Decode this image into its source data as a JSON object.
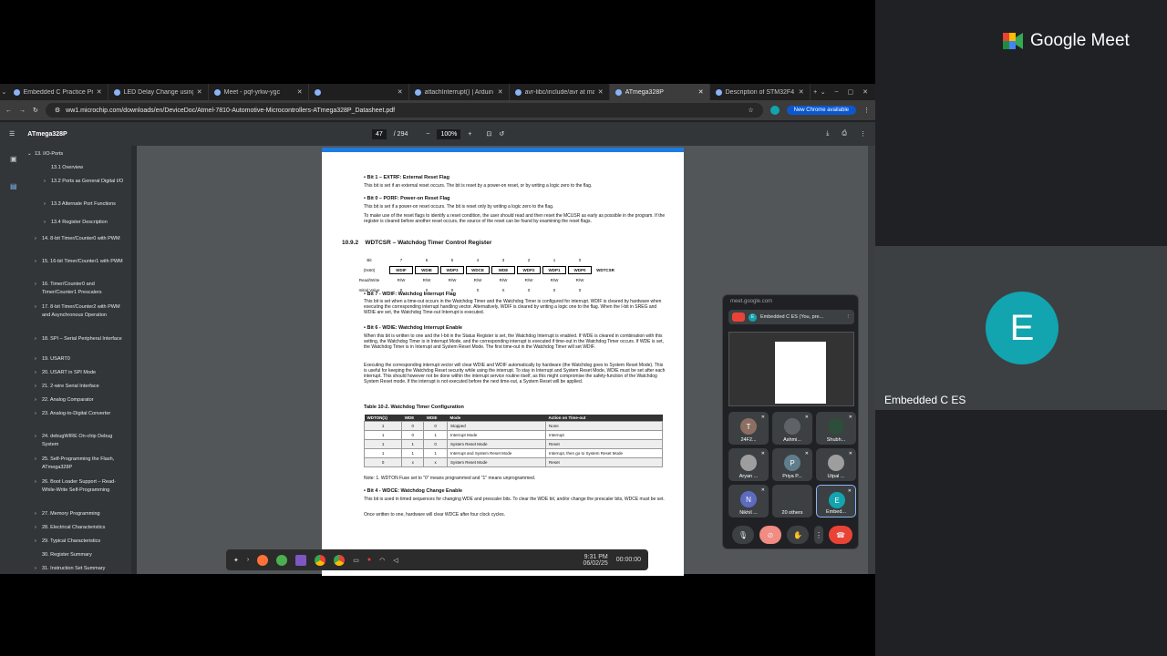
{
  "meet": {
    "logo_text": "Google Meet",
    "right_name": "Embedded C ES",
    "right_initial": "E",
    "popup_url": "meet.google.com",
    "presenting_label": "Embedded C ES (You, pre...",
    "popup_initial": "E"
  },
  "tiles": [
    {
      "name": "24F2...",
      "initial": "T",
      "bg": "#8d6e63"
    },
    {
      "name": "Ashmi...",
      "initial": "",
      "bg": "#5f6368"
    },
    {
      "name": "Shubh...",
      "initial": "",
      "bg": "#2e4d3a"
    },
    {
      "name": "Aryan ...",
      "initial": "",
      "bg": "#9e9e9e"
    },
    {
      "name": "Priya P...",
      "initial": "P",
      "bg": "#607d8b"
    },
    {
      "name": "Utpal ...",
      "initial": "",
      "bg": "#9e9e9e"
    },
    {
      "name": "Nikhil ...",
      "initial": "N",
      "bg": "#5c6bc0"
    },
    {
      "name": "20 others",
      "initial": "",
      "bg": "#3c4043"
    },
    {
      "name": "Embed...",
      "initial": "E",
      "bg": "#12a4af"
    }
  ],
  "browser": {
    "tabs": [
      "Embedded C Practice Prog",
      "LED Delay Change using",
      "Meet - pqf-yrkw-ygc",
      "",
      "attachInterrupt() | Arduin",
      "avr-libc/include/avr at ma",
      "ATmega328P",
      "Description of STM32F4 H"
    ],
    "active_tab": 6,
    "url": "ww1.microchip.com/downloads/en/DeviceDoc/Atmel-7810-Automotive-Microcontrollers-ATmega328P_Datasheet.pdf",
    "new_chrome": "New Chrome available"
  },
  "pdf": {
    "title": "ATmega328P",
    "page": "47",
    "total": "/ 294",
    "zoom": "100%"
  },
  "sidebar": [
    "13. I/O-Ports",
    "13.1 Overview",
    "13.2 Ports as General Digital I/O",
    "13.3 Alternate Port Functions",
    "13.4 Register Description",
    "14. 8-bit Timer/Counter0 with PWM",
    "15. 16-bit Timer/Counter1 with PWM",
    "16. Timer/Counter0 and Timer/Counter1 Prescalers",
    "17. 8-bit Timer/Counter2 with PWM and Asynchronous Operation",
    "18. SPI – Serial Peripheral Interface",
    "19. USART0",
    "20. USART in SPI Mode",
    "21. 2-wire Serial Interface",
    "22. Analog Comparator",
    "23. Analog-to-Digital Converter",
    "24. debugWIRE On-chip Debug System",
    "25. Self-Programming the Flash, ATmega328P",
    "26. Boot Loader Support – Read-While-Write Self-Programming",
    "27. Memory Programming",
    "28. Electrical Characteristics",
    "29. Typical Characteristics",
    "30. Register Summary",
    "31. Instruction Set Summary"
  ],
  "doc": {
    "b1_head": "Bit 1 – EXTRF: External Reset Flag",
    "b1_text": "This bit is set if an external reset occurs. The bit is reset by a power-on reset, or by writing a logic zero to the flag.",
    "b0_head": "Bit 0 – PORF: Power-on Reset Flag",
    "b0_text": "This bit is set if a power-on reset occurs. The bit is reset only by writing a logic zero to the flag.",
    "reset_text": "To make use of the reset flags to identify a reset condition, the user should read and then reset the MCUSR as early as possible in the program. If the register is cleared before another reset occurs, the source of the reset can be found by examining the reset flags.",
    "sec_num": "10.9.2",
    "sec_title": "WDTCSR – Watchdog Timer Control Register",
    "reg_bits": [
      "7",
      "6",
      "5",
      "4",
      "3",
      "2",
      "1",
      "0"
    ],
    "reg_names": [
      "WDIF",
      "WDIE",
      "WDP3",
      "WDCE",
      "WDE",
      "WDP2",
      "WDP1",
      "WDP0"
    ],
    "reg_rw": [
      "R/W",
      "R/W",
      "R/W",
      "R/W",
      "R/W",
      "R/W",
      "R/W",
      "R/W"
    ],
    "reg_init": [
      "0",
      "0",
      "0",
      "0",
      "X",
      "0",
      "0",
      "0"
    ],
    "reg_label": "WDTCSR",
    "reg_addr": "(0x60)",
    "row_bit": "Bit",
    "row_rw": "Read/Write",
    "row_init": "Initial Value",
    "b7_head": "Bit 7 - WDIF: Watchdog Interrupt Flag",
    "b7_text": "This bit is set when a time-out occurs in the Watchdog Timer and the Watchdog Timer is configured for interrupt. WDIF is cleared by hardware when executing the corresponding interrupt handling vector. Alternatively, WDIF is cleared by writing a logic one to the flag. When the I-bit in SREG and WDIE are set, the Watchdog Time-out Interrupt is executed.",
    "b6_head": "Bit 6 - WDIE: Watchdog Interrupt Enable",
    "b6_text": "When this bit is written to one and the I-bit in the Status Register is set, the Watchdog Interrupt is enabled. If WDE is cleared in combination with this setting, the Watchdog Timer is in Interrupt Mode, and the corresponding interrupt is executed if time-out in the Watchdog Timer occurs. If WDE is set, the Watchdog Timer is in Interrupt and System Reset Mode. The first time-out in the Watchdog Timer will set WDIF.",
    "b6_text2": "Executing the corresponding interrupt vector will clear WDIE and WDIF automatically by hardware (the Watchdog goes to System Reset Mode). This is useful for keeping the Watchdog Reset security while using the interrupt. To stay in Interrupt and System Reset Mode, WDIE must be set after each interrupt. This should however not be done within the interrupt service routine itself, as this might compromise the safety-function of the Watchdog System Reset mode. If the interrupt is not executed before the next time-out, a System Reset will be applied.",
    "table_title": "Table 10-2.   Watchdog Timer Configuration",
    "table_headers": [
      "WDTON(1)",
      "WDE",
      "WDIE",
      "Mode",
      "Action on Time-out"
    ],
    "table_rows": [
      [
        "1",
        "0",
        "0",
        "Stopped",
        "None"
      ],
      [
        "1",
        "0",
        "1",
        "Interrupt Mode",
        "Interrupt"
      ],
      [
        "1",
        "1",
        "0",
        "System Reset Mode",
        "Reset"
      ],
      [
        "1",
        "1",
        "1",
        "Interrupt and System Reset Mode",
        "Interrupt, then go to System Reset Mode"
      ],
      [
        "0",
        "x",
        "x",
        "System Reset Mode",
        "Reset"
      ]
    ],
    "note": "Note:    1.    WDTON Fuse set to \"0\" means programmed and \"1\" means unprogrammed.",
    "b4_head": "Bit 4 - WDCE: Watchdog Change Enable",
    "b4_text": "This bit is used in timed sequences for changing WDE and prescaler bits. To clear the WDE bit, and/or change the prescaler bits, WDCE must be set.",
    "b4_text2": "Once written to one, hardware will clear WDCE after four clock cycles."
  },
  "taskbar": {
    "time": "9:31 PM",
    "date": "06/02/25",
    "rec": "00:00:00"
  }
}
